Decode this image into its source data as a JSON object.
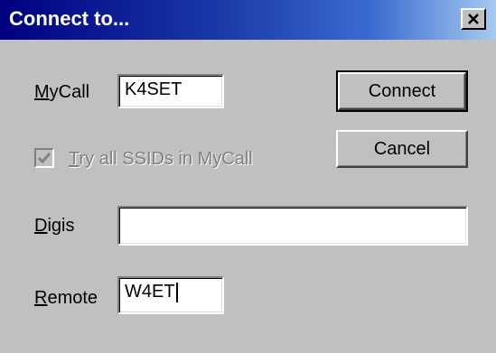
{
  "window": {
    "title": "Connect to..."
  },
  "form": {
    "mycall": {
      "label_mnemonic": "M",
      "label_rest": "yCall",
      "value": "K4SET"
    },
    "try_ssids": {
      "label_mnemonic": "T",
      "label_rest": "ry all SSIDs in MyCall",
      "checked": true,
      "disabled": true
    },
    "digis": {
      "label_mnemonic": "D",
      "label_rest": "igis",
      "value": ""
    },
    "remote": {
      "label_mnemonic": "R",
      "label_rest": "emote",
      "value": "W4ET"
    }
  },
  "buttons": {
    "connect_label": "Connect",
    "cancel_label": "Cancel"
  },
  "icons": {
    "close": "close-icon",
    "check": "checkmark-icon"
  },
  "colors": {
    "titlebar_start": "#000080",
    "titlebar_end": "#a6caf0",
    "dialog_face": "#c0c0c0"
  }
}
